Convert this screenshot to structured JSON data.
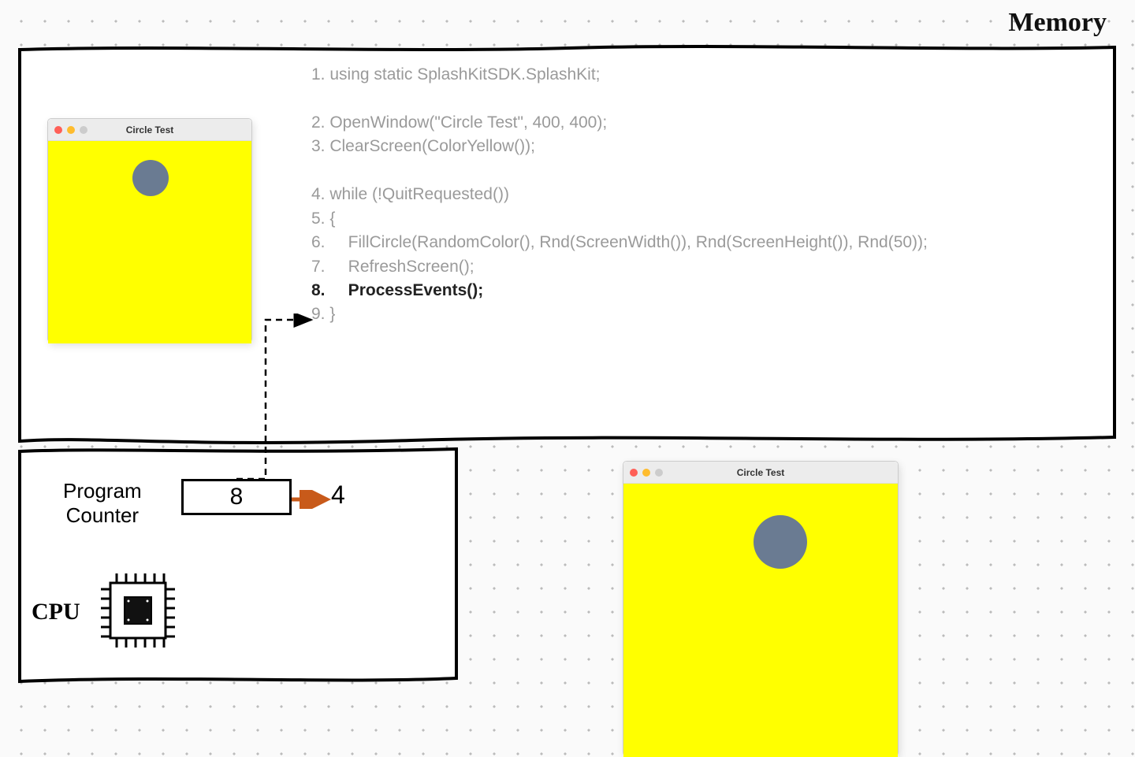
{
  "memory": {
    "label": "Memory"
  },
  "code": {
    "lines": [
      {
        "n": "1.",
        "text": "using static SplashKitSDK.SplashKit;",
        "blank_after": true
      },
      {
        "n": "2.",
        "text": "OpenWindow(\"Circle Test\", 400, 400);"
      },
      {
        "n": "3.",
        "text": "ClearScreen(ColorYellow());",
        "blank_after": true
      },
      {
        "n": "4.",
        "text": "while (!QuitRequested())"
      },
      {
        "n": "5.",
        "text": "{"
      },
      {
        "n": "6.",
        "text": "    FillCircle(RandomColor(), Rnd(ScreenWidth()), Rnd(ScreenHeight()), Rnd(50));"
      },
      {
        "n": "7.",
        "text": "    RefreshScreen();"
      },
      {
        "n": "8.",
        "text": "    ProcessEvents();",
        "active": true
      },
      {
        "n": "9.",
        "text": "}"
      }
    ]
  },
  "window": {
    "title": "Circle Test",
    "bg": "#ffff00",
    "circle_color": "#6a7b92"
  },
  "cpu": {
    "pc_label": "Program\nCounter",
    "pc_value": "8",
    "pc_next": "4",
    "label": "CPU"
  }
}
